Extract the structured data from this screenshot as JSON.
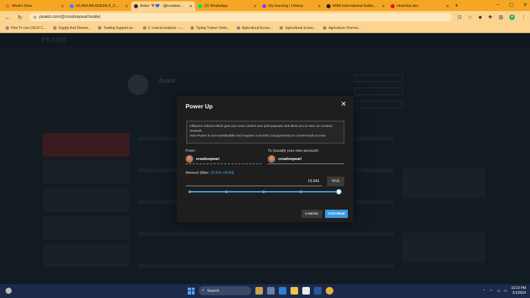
{
  "browser": {
    "tabs": [
      {
        "title": "What's New",
        "color": "#e07b39",
        "active": false
      },
      {
        "title": "OLAWUMI ADEDEJI_CHAPTER",
        "color": "#4285f4",
        "active": false
      },
      {
        "title": "Ardor 🎈💙 - @creativepearl",
        "color": "#333333",
        "active": true
      },
      {
        "title": "(2) WhatsApp",
        "color": "#25d366",
        "active": false
      },
      {
        "title": "My learning | Udemy",
        "color": "#a435f0",
        "active": false
      },
      {
        "title": "MSN International Edition - W",
        "color": "#222222",
        "active": false
      },
      {
        "title": "HiveHub.dev",
        "color": "#e31337",
        "active": false
      }
    ],
    "url": "peakd.com/@creativepearl/wallet",
    "bookmarks": [
      "How To Use DSLR C...",
      "Supply And Deman...",
      "Trading Support an...",
      "2. Lexical analysis —...",
      "Typing Trainer Onlin...",
      "Agricultural Econo...",
      "Agricultural Econo...",
      "Agriculture Overvie..."
    ],
    "profile_initial": "A"
  },
  "background": {
    "logo": "PEAKD",
    "profile_name": "Ardor"
  },
  "modal": {
    "title": "Power Up",
    "info_line1": "Influence tokens which give you more control over post payouts and allow you to earn on curation rewards.",
    "info_line2": "Hive Power is non-transferable and requires 3 months (13 payments) to convert back to Hive.",
    "from_label": "From:",
    "from_user": "creativepearl",
    "to_label": "To (usually your own account):",
    "to_user": "creativepearl",
    "amount_label_prefix": "Amount (Max: ",
    "amount_max": "15.641 HIVE",
    "amount_label_suffix": "):",
    "amount_value": "15.641",
    "currency_button": "HIVE",
    "slider_value": 1.0,
    "cancel_label": "CANCEL",
    "continue_label": "CONTINUE"
  },
  "taskbar": {
    "search_placeholder": "Search",
    "time": "10:23 PM",
    "date": "2/1/2024"
  }
}
